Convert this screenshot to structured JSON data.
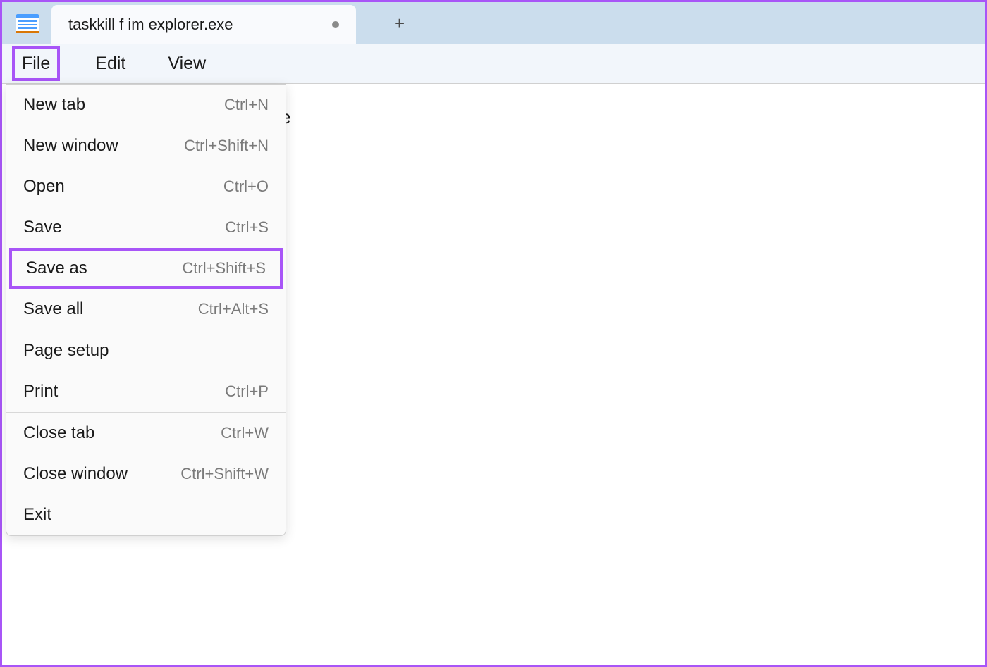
{
  "tab": {
    "title": "taskkill f im explorer.exe",
    "modified": true
  },
  "menubar": {
    "file": "File",
    "edit": "Edit",
    "view": "View"
  },
  "content": {
    "partial_text": "e"
  },
  "file_menu": {
    "groups": [
      [
        {
          "id": "new-tab",
          "label": "New tab",
          "shortcut": "Ctrl+N",
          "highlighted": false
        },
        {
          "id": "new-window",
          "label": "New window",
          "shortcut": "Ctrl+Shift+N",
          "highlighted": false
        },
        {
          "id": "open",
          "label": "Open",
          "shortcut": "Ctrl+O",
          "highlighted": false
        },
        {
          "id": "save",
          "label": "Save",
          "shortcut": "Ctrl+S",
          "highlighted": false
        },
        {
          "id": "save-as",
          "label": "Save as",
          "shortcut": "Ctrl+Shift+S",
          "highlighted": true
        },
        {
          "id": "save-all",
          "label": "Save all",
          "shortcut": "Ctrl+Alt+S",
          "highlighted": false
        }
      ],
      [
        {
          "id": "page-setup",
          "label": "Page setup",
          "shortcut": "",
          "highlighted": false
        },
        {
          "id": "print",
          "label": "Print",
          "shortcut": "Ctrl+P",
          "highlighted": false
        }
      ],
      [
        {
          "id": "close-tab",
          "label": "Close tab",
          "shortcut": "Ctrl+W",
          "highlighted": false
        },
        {
          "id": "close-window",
          "label": "Close window",
          "shortcut": "Ctrl+Shift+W",
          "highlighted": false
        },
        {
          "id": "exit",
          "label": "Exit",
          "shortcut": "",
          "highlighted": false
        }
      ]
    ]
  }
}
